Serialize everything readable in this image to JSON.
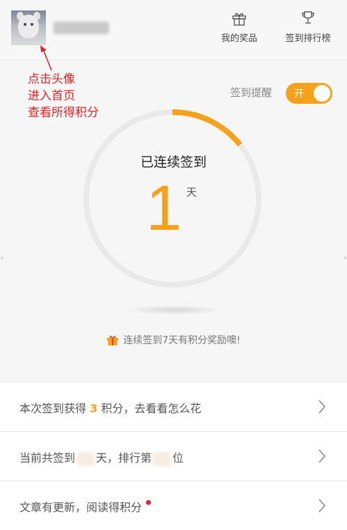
{
  "header": {
    "prizes_label": "我的奖品",
    "ranking_label": "签到排行榜"
  },
  "annotation": {
    "lines": [
      "点击头像",
      "进入首页",
      "查看所得积分"
    ]
  },
  "reminder": {
    "label": "签到提醒",
    "toggle_text": "开",
    "enabled": true
  },
  "streak": {
    "label": "已连续签到",
    "days": "1",
    "unit": "天",
    "progress_fraction": 0.143
  },
  "tip": {
    "text": "连续签到7天有积分奖励噢!"
  },
  "list": {
    "row1": {
      "prefix": "本次签到获得 ",
      "points": "3",
      "suffix": " 积分，去看看怎么花"
    },
    "row2": {
      "prefix": "当前共签到",
      "middle": "天，排行第",
      "suffix": "位"
    },
    "row3": {
      "text": "文章有更新，阅读得积分"
    }
  },
  "colors": {
    "accent": "#f7a11a",
    "annotation": "#e02424"
  }
}
